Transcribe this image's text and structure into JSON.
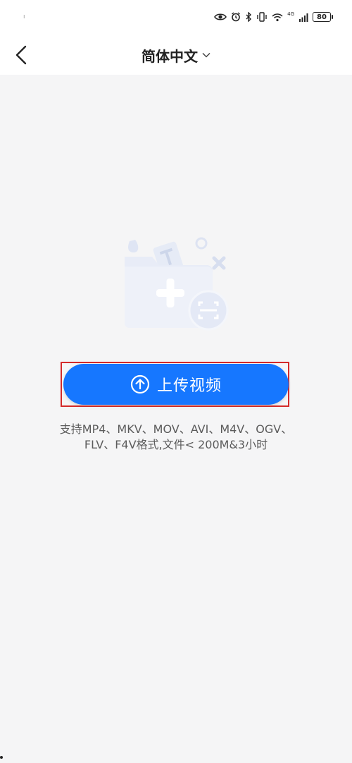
{
  "status_bar": {
    "left_marker": "ı",
    "network_type": "4G",
    "battery_level": "80",
    "icons": [
      "eye-icon",
      "alarm-icon",
      "bluetooth-icon",
      "vibrate-icon",
      "wifi-icon",
      "signal-icon",
      "battery-icon"
    ]
  },
  "header": {
    "title": "简体中文",
    "back_icon": "chevron-left-icon",
    "dropdown_icon": "chevron-down-icon"
  },
  "main": {
    "illustration": "add-folder-illustration",
    "upload_button_label": "上传视频",
    "upload_icon": "arrow-up-circle-icon",
    "hint_text": "支持MP4、MKV、MOV、AVI、M4V、OGV、FLV、F4V格式,文件< 200M&3小时"
  },
  "colors": {
    "accent": "#1677ff",
    "highlight_border": "#d42a2a",
    "background": "#f5f5f6",
    "text": "#222222",
    "hint_text": "#5b5b5b"
  }
}
